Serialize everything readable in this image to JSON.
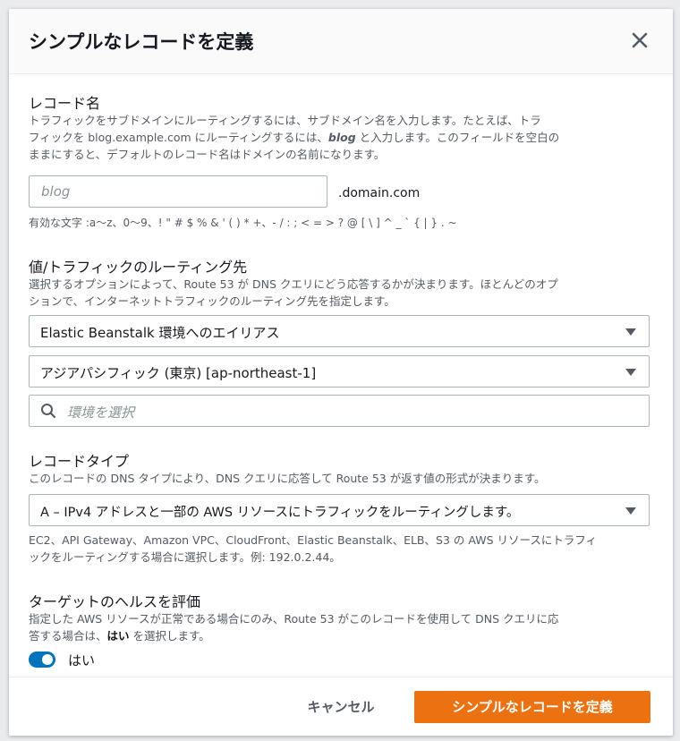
{
  "dialog": {
    "title": "シンプルなレコードを定義",
    "close_icon": "close-icon"
  },
  "record_name": {
    "label": "レコード名",
    "desc_line1": "トラフィックをサブドメインにルーティングするには、サブドメイン名を入力します。たとえば、トラ",
    "desc_line2a": "フィックを blog.example.com にルーティングするには、",
    "desc_line2b": "blog",
    "desc_line2c": " と入力します。このフィールドを空白の",
    "desc_line3": "ままにすると、デフォルトのレコード名はドメインの名前になります。",
    "placeholder": "blog",
    "suffix": ".domain.com",
    "valid_chars": "有効な文字 :a〜z、0〜9、! \" # $ % & ' ( ) * +、- / : ; < = > ? @ [ \\ ] ^ _ ` { | } . ~"
  },
  "routing_target": {
    "label": "値/トラフィックのルーティング先",
    "desc_line1": "選択するオプションによって、Route 53 が DNS クエリにどう応答するかが決まります。ほとんどのオプ",
    "desc_line2": "ションで、インターネットトラフィックのルーティング先を指定します。",
    "alias_select": "Elastic Beanstalk 環境へのエイリアス",
    "region_select": "アジアパシフィック (東京) [ap-northeast-1]",
    "env_placeholder": "環境を選択",
    "search_icon": "search-icon"
  },
  "record_type": {
    "label": "レコードタイプ",
    "desc": "このレコードの DNS タイプにより、DNS クエリに応答して Route 53 が返す値の形式が決まります。",
    "select": "A – IPv4 アドレスと一部の AWS リソースにトラフィックをルーティングします。",
    "help_line1": "EC2、API Gateway、Amazon VPC、CloudFront、Elastic Beanstalk、ELB、S3 の AWS リソースにトラフィ",
    "help_line2": "ックをルーティングする場合に選択します。例: 192.0.2.44。"
  },
  "health": {
    "label": "ターゲットのヘルスを評価",
    "desc_line1": "指定した AWS リソースが正常である場合にのみ、Route 53 がこのレコードを使用して DNS クエリに応",
    "desc_line2a": "答する場合は、",
    "desc_line2b": "はい",
    "desc_line2c": " を選択します。",
    "toggle_label": "はい",
    "toggle_on": true
  },
  "footer": {
    "cancel": "キャンセル",
    "submit": "シンプルなレコードを定義"
  },
  "colors": {
    "primary": "#ec7211",
    "toggle": "#0073bb"
  }
}
